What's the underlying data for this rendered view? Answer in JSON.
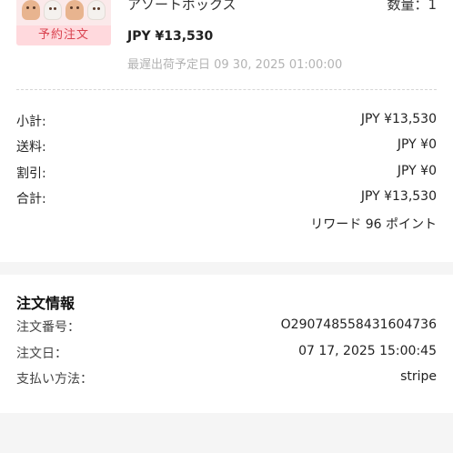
{
  "product": {
    "badge": "予約注文",
    "name": "アソートボックス",
    "quantity": "数量：1",
    "price": "JPY ¥13,530",
    "shipping": "最遅出荷予定日 09 30, 2025 01:00:00"
  },
  "summary": {
    "subtotal_label": "小計:",
    "subtotal_value": "JPY ¥13,530",
    "shipping_label": "送料:",
    "shipping_value": "JPY ¥0",
    "discount_label": "割引:",
    "discount_value": "JPY ¥0",
    "total_label": "合計:",
    "total_value": "JPY ¥13,530",
    "reward": "リワード 96 ポイント"
  },
  "order_info": {
    "title": "注文情報",
    "number_label": "注文番号：",
    "number_value": "O290748558431604736",
    "date_label": "注文日：",
    "date_value": "07 17, 2025 15:00:45",
    "payment_label": "支払い方法：",
    "payment_value": "stripe"
  }
}
